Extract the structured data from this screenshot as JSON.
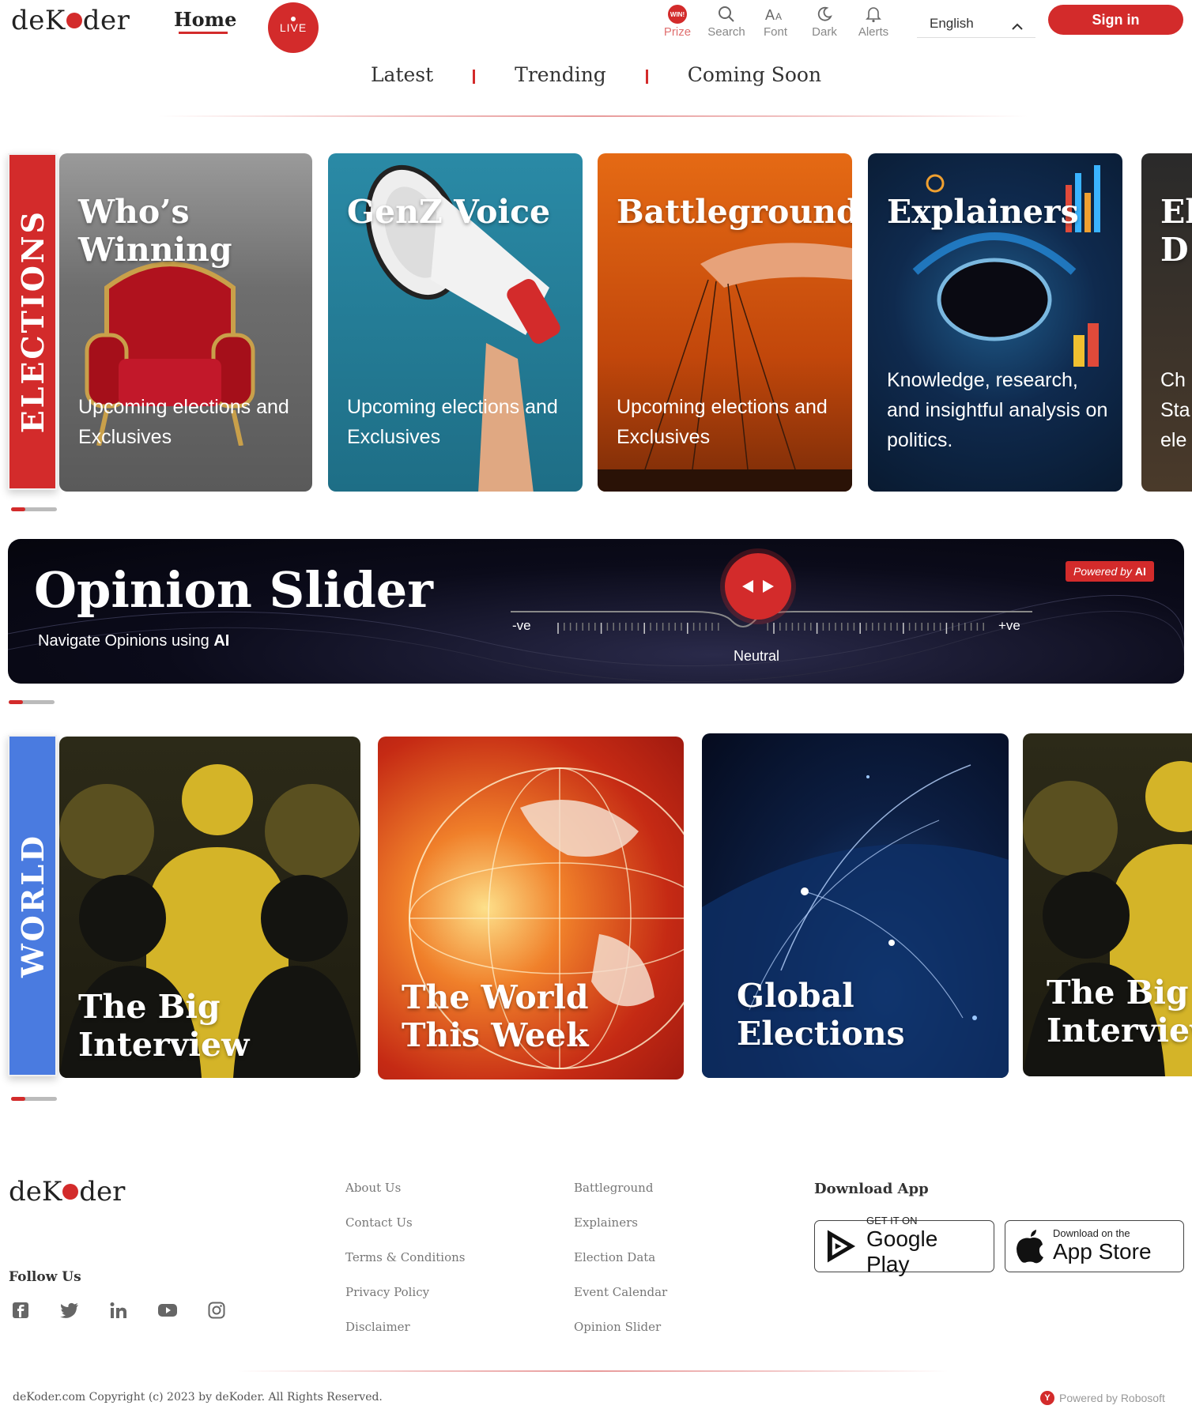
{
  "header": {
    "logo_left": "deK",
    "logo_right": "der",
    "home_label": "Home",
    "live_label": "LIVE",
    "prize_badge": "WIN!",
    "tools": [
      {
        "label": "Prize",
        "icon": "trophy-icon"
      },
      {
        "label": "Search",
        "icon": "search-icon"
      },
      {
        "label": "Font",
        "icon": "font-size-icon"
      },
      {
        "label": "Dark",
        "icon": "moon-icon"
      },
      {
        "label": "Alerts",
        "icon": "bell-icon"
      }
    ],
    "language": "English",
    "signin_label": "Sign in"
  },
  "subnav": {
    "items": [
      "Latest",
      "Trending",
      "Coming Soon"
    ]
  },
  "elections": {
    "section_label": "ELECTIONS",
    "cards": [
      {
        "title": "Who’s Winning",
        "subtitle": "Upcoming elections and Exclusives"
      },
      {
        "title": "GenZ Voice",
        "subtitle": "Upcoming elections and Exclusives"
      },
      {
        "title": "Battleground",
        "subtitle": "Upcoming elections and Exclusives"
      },
      {
        "title": "Explainers",
        "subtitle": "Knowledge, research, and insightful analysis on politics."
      },
      {
        "title": "El D",
        "subtitle": "Ch Sta ele"
      }
    ]
  },
  "opinion": {
    "title": "Opinion Slider",
    "subtitle_prefix": "Navigate Opinions using ",
    "subtitle_bold": "AI",
    "badge_prefix": "Powered by ",
    "badge_bold": "AI",
    "negative_label": "-ve",
    "positive_label": "+ve",
    "neutral_label": "Neutral",
    "slider_value": 0.5
  },
  "world": {
    "section_label": "WORLD",
    "cards": [
      {
        "title": "The Big Interview"
      },
      {
        "title": "The World This Week"
      },
      {
        "title": "Global Elections"
      },
      {
        "title": "The Big Interview"
      }
    ]
  },
  "footer": {
    "follow_label": "Follow Us",
    "socials": [
      "facebook-icon",
      "twitter-icon",
      "linkedin-icon",
      "youtube-icon",
      "instagram-icon"
    ],
    "col1": [
      "About Us",
      "Contact Us",
      "Terms & Conditions",
      "Privacy Policy",
      "Disclaimer"
    ],
    "col2": [
      "Battleground",
      "Explainers",
      "Election Data",
      "Event Calendar",
      "Opinion Slider"
    ],
    "download_title": "Download App",
    "google_small": "GET IT ON",
    "google_big": "Google Play",
    "apple_small": "Download on the",
    "apple_big": "App Store",
    "copyright": "deKoder.com Copyright (c) 2023 by deKoder. All Rights Reserved.",
    "powered": "Powered by Robosoft"
  },
  "colors": {
    "accent": "#d32b2b",
    "world_label": "#4a7be0"
  }
}
